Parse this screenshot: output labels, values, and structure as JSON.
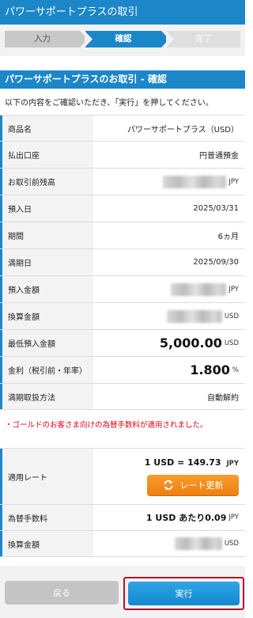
{
  "header": {
    "title": "パワーサポートプラスの取引"
  },
  "steps": [
    {
      "label": "入力"
    },
    {
      "label": "確認"
    },
    {
      "label": "完了"
    }
  ],
  "section": {
    "title": "パワーサポートプラスのお取引 - 確認",
    "intro": "以下の内容をご確認いただき、「実行」を押してください。"
  },
  "rows": {
    "product": {
      "label": "商品名",
      "value": "パワーサポートプラス（USD）"
    },
    "account": {
      "label": "払出口座",
      "value": "円普通預金"
    },
    "balance": {
      "label": "お取引前残高",
      "unit": "JPY"
    },
    "deposit_date": {
      "label": "預入日",
      "value": "2025/03/31"
    },
    "period": {
      "label": "期間",
      "value": "6ヵ月"
    },
    "maturity": {
      "label": "満期日",
      "value": "2025/09/30"
    },
    "deposit_amount": {
      "label": "預入金額",
      "unit": "JPY"
    },
    "converted1": {
      "label": "換算金額",
      "unit": "USD"
    },
    "minimum": {
      "label": "最低預入金額",
      "value": "5,000.00",
      "unit": "USD"
    },
    "rate": {
      "label": "金利（税引前・年率）",
      "value": "1.800",
      "unit": "%"
    },
    "maturity_method": {
      "label": "満期取扱方法",
      "value": "自動解約"
    },
    "fx_rate": {
      "label": "適用レート",
      "value": "1 USD = 149.73",
      "unit": "JPY",
      "button": "レート更新"
    },
    "fee": {
      "label": "為替手数料",
      "value": "1 USD あたり0.09",
      "unit": "JPY"
    },
    "converted2": {
      "label": "換算金額",
      "unit": "USD"
    }
  },
  "notice": "・ゴールドのお客さま向けの為替手数料が適用されました。",
  "footer": {
    "back": "戻る",
    "execute": "実行"
  },
  "colors": {
    "primary": "#1b86c8",
    "orange": "#ef7f10",
    "notice": "#e60012",
    "highlight": "#b2142b"
  }
}
